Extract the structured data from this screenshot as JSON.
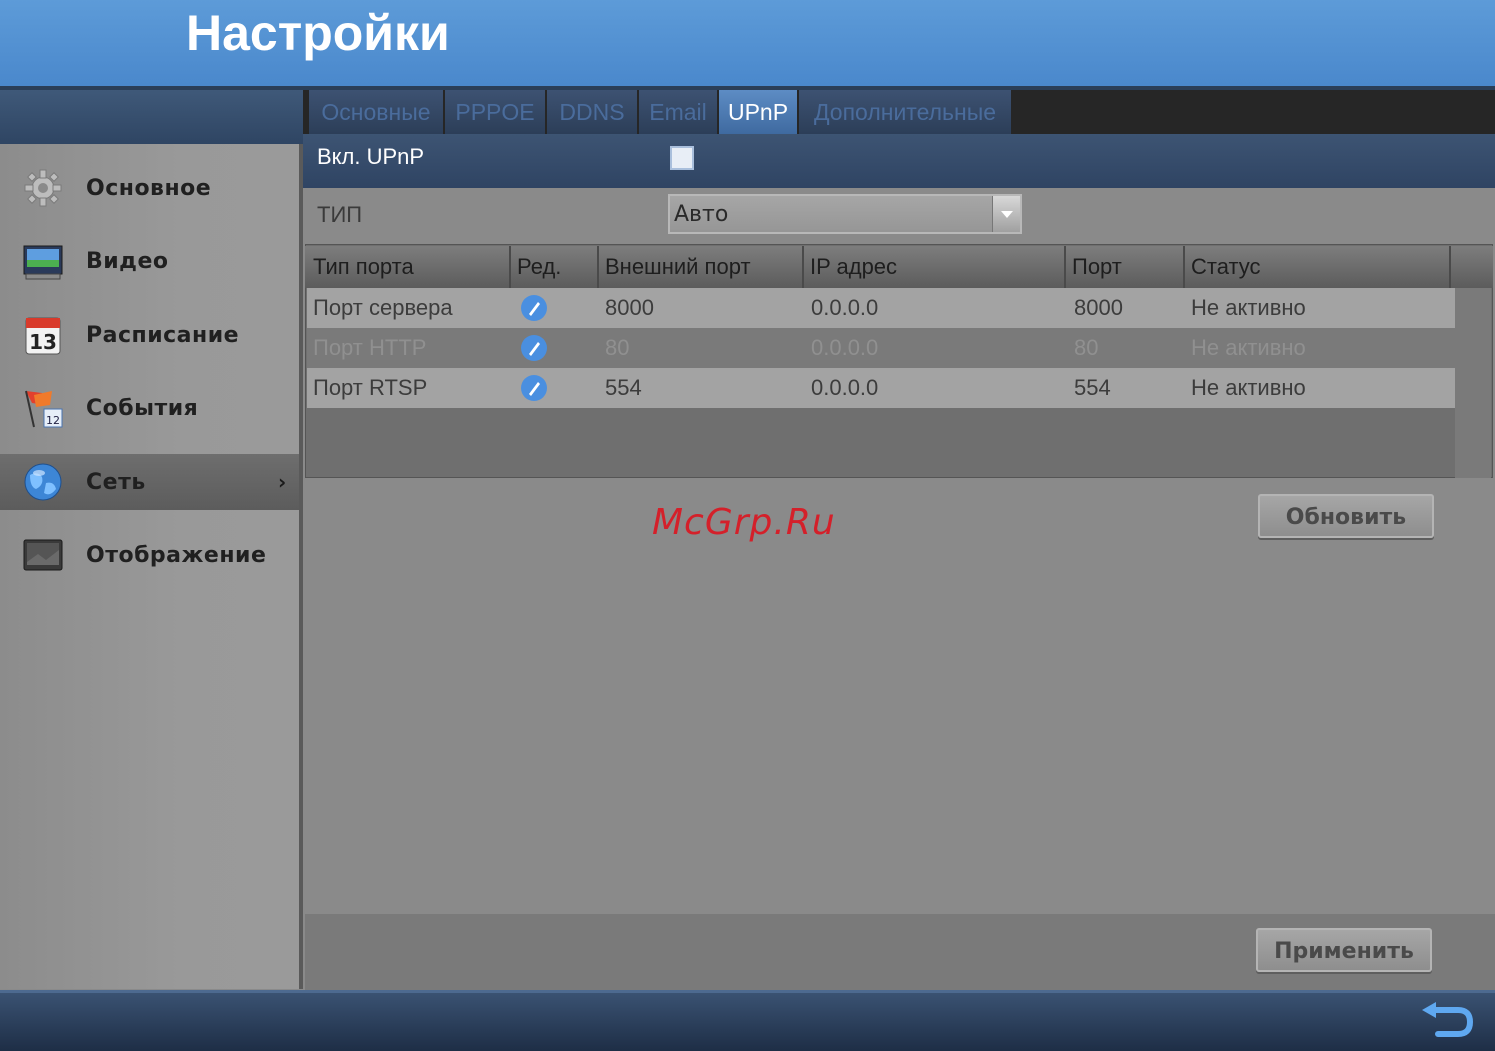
{
  "header": {
    "title": "Настройки"
  },
  "sidebar": {
    "items": [
      {
        "label": "Основное",
        "icon": "gear-icon",
        "active": false
      },
      {
        "label": "Видео",
        "icon": "video-monitor-icon",
        "active": false
      },
      {
        "label": "Расписание",
        "icon": "calendar-icon",
        "active": false
      },
      {
        "label": "События",
        "icon": "event-flag-icon",
        "active": false
      },
      {
        "label": "Сеть",
        "icon": "globe-icon",
        "active": true,
        "arrow": "›"
      },
      {
        "label": "Отображение",
        "icon": "display-icon",
        "active": false
      }
    ]
  },
  "tabs": [
    {
      "label": "Основные",
      "active": false
    },
    {
      "label": "PPPOE",
      "active": false
    },
    {
      "label": "DDNS",
      "active": false
    },
    {
      "label": "Email",
      "active": false
    },
    {
      "label": "UPnP",
      "active": true
    },
    {
      "label": "Дополнительные",
      "active": false
    }
  ],
  "form": {
    "enable_label": "Вкл. UPnP",
    "enable_checked": false,
    "type_label": "ТИП",
    "type_value": "Авто"
  },
  "table": {
    "headers": [
      "Тип порта",
      "Ред.",
      "Внешний порт",
      "IP адрес",
      "Порт",
      "Статус"
    ],
    "rows": [
      {
        "type": "Порт сервера",
        "external_port": "8000",
        "ip": "0.0.0.0",
        "port": "8000",
        "status": "Не активно"
      },
      {
        "type": "Порт HTTP",
        "external_port": "80",
        "ip": "0.0.0.0",
        "port": "80",
        "status": "Не активно"
      },
      {
        "type": "Порт RTSP",
        "external_port": "554",
        "ip": "0.0.0.0",
        "port": "554",
        "status": "Не активно"
      }
    ]
  },
  "buttons": {
    "refresh": "Обновить",
    "apply": "Применить"
  },
  "watermark": "McGrp.Ru",
  "colors": {
    "header": "#4a88cc",
    "active_tab": "#5d8cc4",
    "watermark": "#d4202a"
  }
}
